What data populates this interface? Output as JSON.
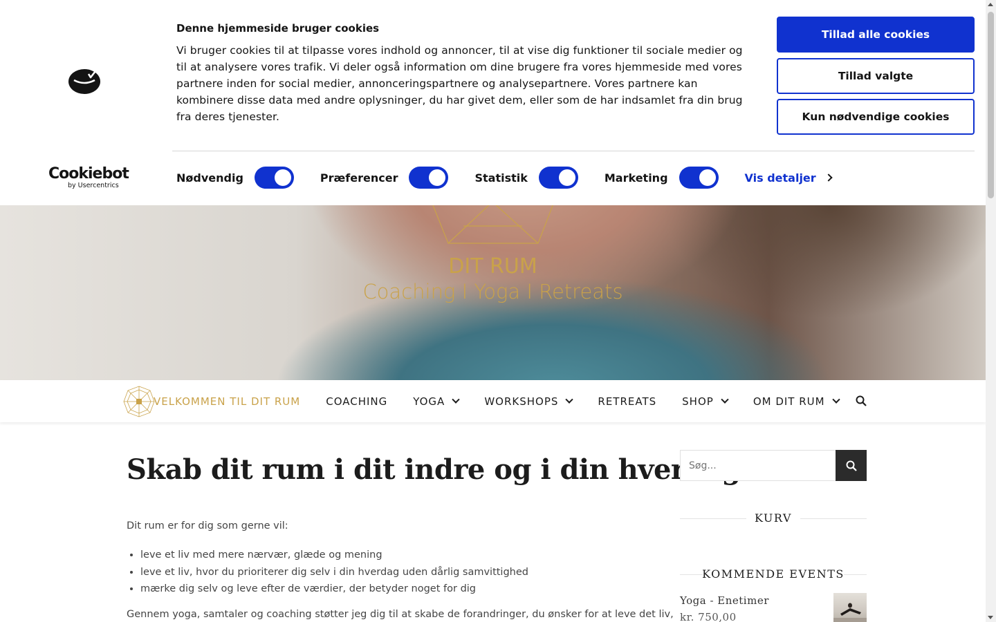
{
  "cookie_banner": {
    "title": "Denne hjemmeside bruger cookies",
    "text": "Vi bruger cookies til at tilpasse vores indhold og annoncer, til at vise dig funktioner til sociale medier og til at analysere vores trafik. Vi deler også information om dine brugere fra vores hjemmeside med vores partnere inden for social medier, annonceringspartnere og analysepartnere. Vores partnere kan kombinere disse data med andre oplysninger, du har givet dem, eller som de har indsamlet fra din brug fra deres tjenester.",
    "brand_name": "Cookiebot",
    "brand_by": "by Usercentrics",
    "buttons": {
      "allow_all": "Tillad alle cookies",
      "allow_selected": "Tillad valgte",
      "necessary_only": "Kun nødvendige cookies"
    },
    "toggles": [
      {
        "label": "Nødvendig",
        "on": true
      },
      {
        "label": "Præferencer",
        "on": true
      },
      {
        "label": "Statistik",
        "on": true
      },
      {
        "label": "Marketing",
        "on": true
      }
    ],
    "details_link": "Vis detaljer",
    "colors": {
      "accent": "#1032cf"
    }
  },
  "hero": {
    "name": "DIT RUM",
    "tagline": "Coaching I Yoga I Retreats",
    "colors": {
      "gold": "#c9a24a"
    }
  },
  "nav": {
    "items": [
      {
        "label": "VELKOMMEN TIL DIT RUM",
        "active": true
      },
      {
        "label": "COACHING"
      },
      {
        "label": "YOGA",
        "dropdown": true
      },
      {
        "label": "WORKSHOPS",
        "dropdown": true
      },
      {
        "label": "RETREATS"
      },
      {
        "label": "SHOP",
        "dropdown": true
      },
      {
        "label": "OM DIT RUM",
        "dropdown": true
      }
    ],
    "search_icon": "search-icon"
  },
  "content": {
    "title": "Skab dit rum i dit indre og i din hverdag",
    "intro": "Dit rum er for dig som gerne vil:",
    "bullets": [
      "leve et liv med mere nærvær, glæde og mening",
      "leve et liv, hvor du prioriterer dig selv i din hverdag uden dårlig samvittighed",
      "mærke dig selv og leve efter de værdier, der betyder noget for dig"
    ],
    "paragraph": "Gennem yoga, samtaler og coaching støtter jeg dig til at skabe de forandringer, du ønsker for at leve det liv,"
  },
  "sidebar": {
    "search_placeholder": "Søg...",
    "cart_title": "KURV",
    "events_title": "KOMMENDE EVENTS",
    "event": {
      "title": "Yoga - Enetimer",
      "price": "kr. 750,00"
    }
  }
}
